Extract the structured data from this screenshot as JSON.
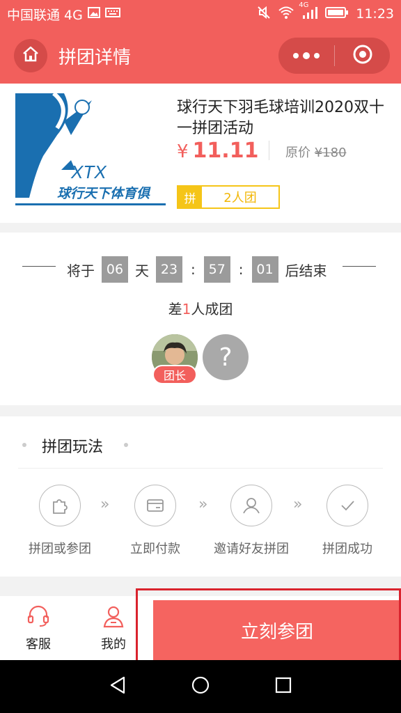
{
  "status_bar": {
    "carrier": "中国联通 4G",
    "network": "4G",
    "time": "11:23"
  },
  "header": {
    "title": "拼团详情"
  },
  "product": {
    "title": "球行天下羽毛球培训2020双十一拼团活动",
    "price_symbol": "¥",
    "price": "11.11",
    "original_label": "原价",
    "original_price": "¥180",
    "tag_pin": "拼",
    "tag_team": "2人团",
    "logo_text": "XTX",
    "logo_subtext": "球行天下体育俱"
  },
  "countdown": {
    "prefix": "将于",
    "days": "06",
    "day_unit": "天",
    "hours": "23",
    "minutes": "57",
    "seconds": "01",
    "colon": ":",
    "suffix": "后结束",
    "short_prefix": "差",
    "short_count": "1",
    "short_suffix": "人成团",
    "leader_badge": "团长",
    "empty_slot": "?"
  },
  "rules": {
    "title": "拼团玩法",
    "arrow": "»",
    "steps": [
      {
        "label": "拼团或参团",
        "icon": "puzzle-icon"
      },
      {
        "label": "立即付款",
        "icon": "card-icon"
      },
      {
        "label": "邀请好友拼团",
        "icon": "user-invite-icon"
      },
      {
        "label": "拼团成功",
        "icon": "check-icon"
      }
    ]
  },
  "bottom_bar": {
    "service_label": "客服",
    "mine_label": "我的",
    "join_label": "立刻参团"
  },
  "colors": {
    "primary": "#f25f5c",
    "capsule": "#d54b49",
    "tag_yellow": "#f5c518",
    "highlight_border": "#d9232d"
  }
}
